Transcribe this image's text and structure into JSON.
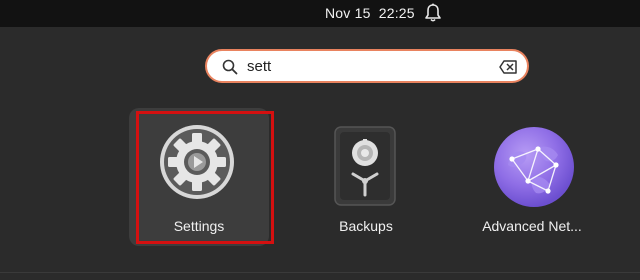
{
  "topbar": {
    "date": "Nov 15",
    "time": "22:25",
    "bell_icon": "bell-icon"
  },
  "search": {
    "value": "sett",
    "search_icon": "search-icon",
    "clear_icon": "backspace-clear-icon",
    "accent_color": "#e9835f"
  },
  "apps": [
    {
      "label": "Settings",
      "icon": "settings-gear-icon",
      "selected": true
    },
    {
      "label": "Backups",
      "icon": "backups-safe-icon",
      "selected": false
    },
    {
      "label": "Advanced Net...",
      "icon": "advanced-network-globe-icon",
      "selected": false
    }
  ],
  "annotation": {
    "highlight_color": "#d41010"
  }
}
